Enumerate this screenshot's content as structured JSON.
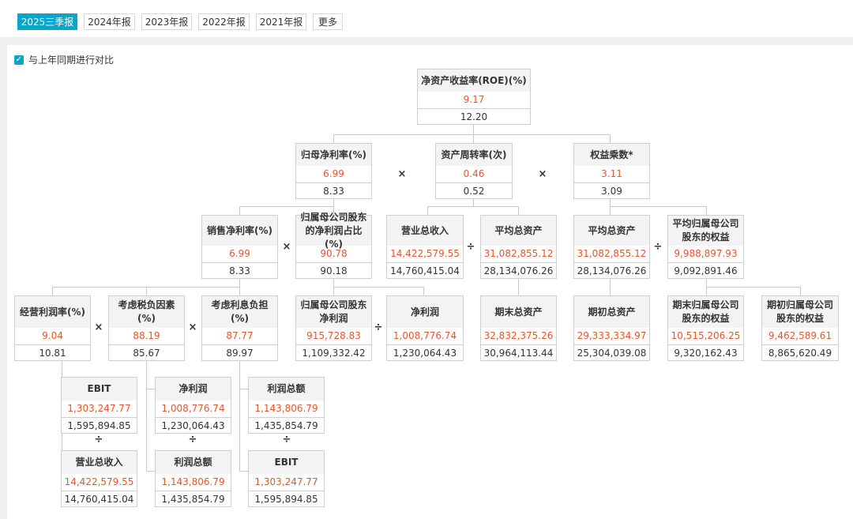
{
  "tabs": [
    {
      "label": "2025三季报",
      "active": true
    },
    {
      "label": "2024年报"
    },
    {
      "label": "2023年报"
    },
    {
      "label": "2022年报"
    },
    {
      "label": "2021年报"
    },
    {
      "label": "更多"
    }
  ],
  "compare": {
    "label": "与上年同期进行对比",
    "checked": true
  },
  "colors": {
    "accent": "#0aa5c8",
    "current": "#e4572e",
    "line": "#c8c8c8"
  },
  "boxes": {
    "roe": {
      "title": "净资产收益率(ROE)(%)",
      "current": "9.17",
      "prior": "12.20"
    },
    "net_margin_parent": {
      "title": "归母净利率(%)",
      "current": "6.99",
      "prior": "8.33"
    },
    "asset_turnover": {
      "title": "资产周转率(次)",
      "current": "0.46",
      "prior": "0.52"
    },
    "equity_multiplier": {
      "title": "权益乘数*",
      "current": "3.11",
      "prior": "3.09"
    },
    "sales_net_margin": {
      "title": "销售净利率(%)",
      "current": "6.99",
      "prior": "8.33"
    },
    "parent_profit_share": {
      "title": "归属母公司股东的净利润占比(%)",
      "current": "90.78",
      "prior": "90.18"
    },
    "revenue_a": {
      "title": "营业总收入",
      "current": "14,422,579.55",
      "prior": "14,760,415.04"
    },
    "avg_assets_a": {
      "title": "平均总资产",
      "current": "31,082,855.12",
      "prior": "28,134,076.26"
    },
    "avg_assets_b": {
      "title": "平均总资产",
      "current": "31,082,855.12",
      "prior": "28,134,076.26"
    },
    "avg_parent_equity": {
      "title": "平均归属母公司股东的权益",
      "current": "9,988,897.93",
      "prior": "9,092,891.46"
    },
    "op_margin": {
      "title": "经营利润率(%)",
      "current": "9.04",
      "prior": "10.81"
    },
    "tax_factor": {
      "title": "考虑税负因素(%)",
      "current": "88.19",
      "prior": "85.67"
    },
    "interest_burden": {
      "title": "考虑利息负担(%)",
      "current": "87.77",
      "prior": "89.97"
    },
    "parent_net_profit": {
      "title": "归属母公司股东净利润",
      "current": "915,728.83",
      "prior": "1,109,332.42"
    },
    "net_profit_a": {
      "title": "净利润",
      "current": "1,008,776.74",
      "prior": "1,230,064.43"
    },
    "end_assets": {
      "title": "期末总资产",
      "current": "32,832,375.26",
      "prior": "30,964,113.44"
    },
    "begin_assets": {
      "title": "期初总资产",
      "current": "29,333,334.97",
      "prior": "25,304,039.08"
    },
    "end_parent_equity": {
      "title": "期末归属母公司股东的权益",
      "current": "10,515,206.25",
      "prior": "9,320,162.43"
    },
    "begin_parent_equity": {
      "title": "期初归属母公司股东的权益",
      "current": "9,462,589.61",
      "prior": "8,865,620.49"
    },
    "ebit_a": {
      "title": "EBIT",
      "current": "1,303,247.77",
      "prior": "1,595,894.85"
    },
    "net_profit_b": {
      "title": "净利润",
      "current": "1,008,776.74",
      "prior": "1,230,064.43"
    },
    "total_profit_a": {
      "title": "利润总额",
      "current": "1,143,806.79",
      "prior": "1,435,854.79"
    },
    "revenue_b": {
      "title": "营业总收入",
      "current": "14,422,579.55",
      "prior": "14,760,415.04"
    },
    "total_profit_b": {
      "title": "利润总额",
      "current": "1,143,806.79",
      "prior": "1,435,854.79"
    },
    "ebit_b": {
      "title": "EBIT",
      "current": "1,303,247.77",
      "prior": "1,595,894.85"
    }
  },
  "operators": {
    "multiply": "×",
    "divide": "÷"
  }
}
